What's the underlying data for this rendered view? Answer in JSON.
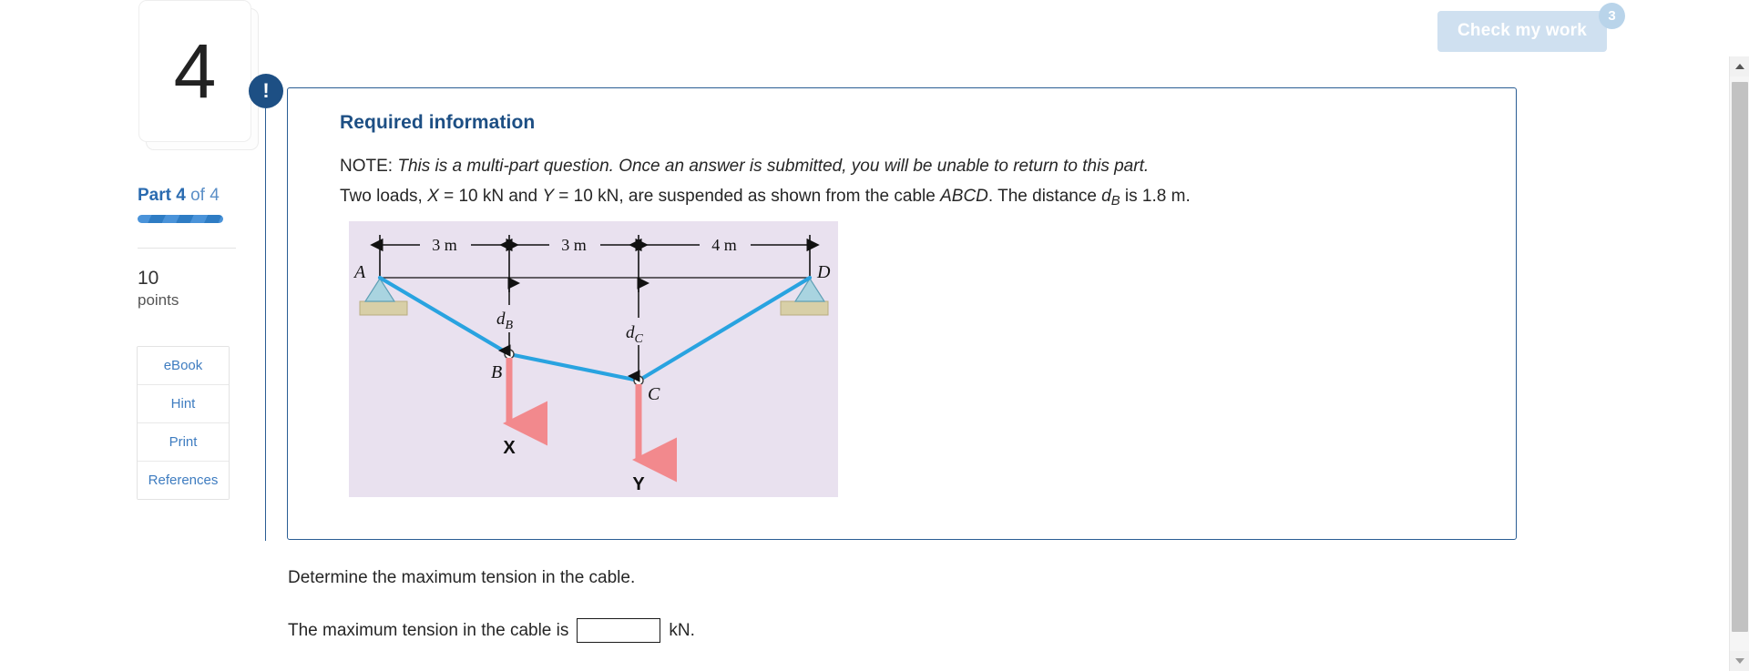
{
  "check_work": {
    "label": "Check my work",
    "badge": "3"
  },
  "rail": {
    "question_number": "4",
    "part_prefix": "Part ",
    "part_current": "4",
    "part_of": " of 4",
    "points_value": "10",
    "points_word": "points",
    "buttons": [
      {
        "label": "eBook"
      },
      {
        "label": "Hint"
      },
      {
        "label": "Print"
      },
      {
        "label": "References"
      }
    ]
  },
  "callout": {
    "bang_icon": "!",
    "title": "Required information",
    "note_prefix": "NOTE: ",
    "note_italic": "This is a multi-part question. Once an answer is submitted, you will be unable to return to this part.",
    "loads_p1": "Two loads, ",
    "loads_x_sym": "X",
    "loads_p2": " = 10 kN and ",
    "loads_y_sym": "Y",
    "loads_p3": " = 10 kN, are suspended as shown from the cable ",
    "loads_cable": "ABCD",
    "loads_p4": ". The distance ",
    "loads_d_sym": "d",
    "loads_d_subscript": "B",
    "loads_p5": " is 1.8 m."
  },
  "figure": {
    "dim_ab": "3 m",
    "dim_bc": "3 m",
    "dim_cd": "4 m",
    "label_a": "A",
    "label_b": "B",
    "label_c": "C",
    "label_d": "D",
    "label_db": "d",
    "label_db_sub": "B",
    "label_dc": "d",
    "label_dc_sub": "C",
    "load_x": "X",
    "load_y": "Y"
  },
  "question": {
    "prompt": "Determine the maximum tension in the cable.",
    "answer_prefix": "The maximum tension in the cable is",
    "answer_value": "",
    "answer_placeholder": "",
    "answer_unit": "kN."
  },
  "scrollbar": {
    "up_icon": "scroll-up-arrow",
    "down_icon": "scroll-down-arrow"
  },
  "colors": {
    "accent_blue": "#1d4f84",
    "link_blue": "#3e7cc0",
    "cable_blue": "#29a3e0",
    "load_red": "#f2898d",
    "figure_bg": "#e9e1ef"
  }
}
